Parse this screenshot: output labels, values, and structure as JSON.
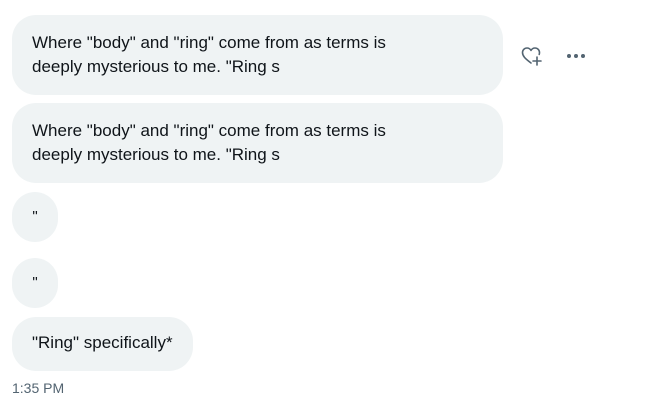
{
  "messages": [
    {
      "lines": [
        "Where \"body\" and \"ring\" come from as terms is",
        "deeply mysterious to me. \"Ring s"
      ]
    },
    {
      "lines": [
        "Where \"body\" and \"ring\" come from as terms is",
        "deeply mysterious to me. \"Ring s"
      ]
    },
    {
      "text": "\""
    },
    {
      "text": "\""
    },
    {
      "text": "\"Ring\" specifically*"
    }
  ],
  "actions": {
    "react_icon": "heart-plus-icon",
    "more_icon": "more-horizontal-icon"
  },
  "timestamp": "1:35 PM",
  "colors": {
    "bubble_bg": "#eff3f4",
    "text": "#0f1419",
    "muted": "#536471"
  }
}
